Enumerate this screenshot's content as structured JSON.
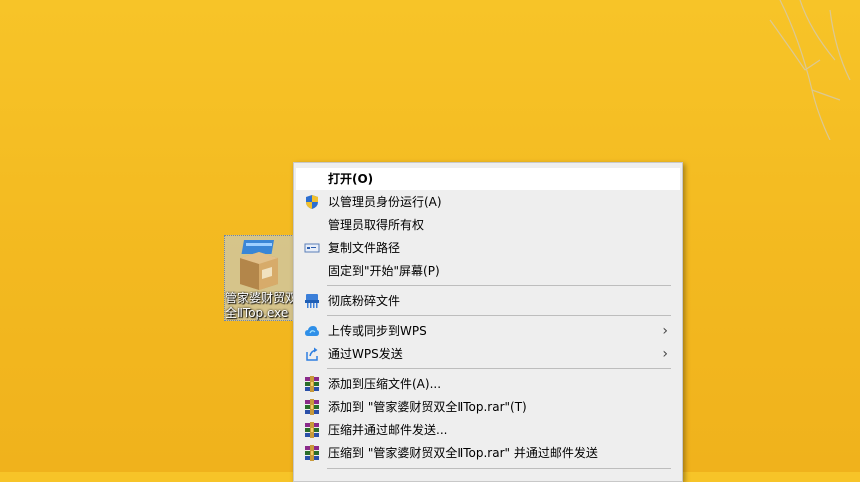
{
  "desktop": {
    "icon_label_line1": "管家婆财贸双",
    "icon_label_line2": "全ⅡTop.exe"
  },
  "context_menu": {
    "items": [
      {
        "label": "打开(O)",
        "icon": "none",
        "bold": true
      },
      {
        "label": "以管理员身份运行(A)",
        "icon": "uac-shield-icon"
      },
      {
        "label": "管理员取得所有权",
        "icon": "none"
      },
      {
        "label": "复制文件路径",
        "icon": "copy-path-icon"
      },
      {
        "label": "固定到\"开始\"屏幕(P)",
        "icon": "none"
      },
      {
        "label": "彻底粉碎文件",
        "icon": "shredder-icon"
      },
      {
        "label": "上传或同步到WPS",
        "icon": "wps-cloud-icon",
        "submenu": true
      },
      {
        "label": "通过WPS发送",
        "icon": "share-icon",
        "submenu": true
      },
      {
        "label": "添加到压缩文件(A)...",
        "icon": "winrar-icon"
      },
      {
        "label": "添加到 \"管家婆财贸双全ⅡTop.rar\"(T)",
        "icon": "winrar-icon"
      },
      {
        "label": "压缩并通过邮件发送...",
        "icon": "winrar-icon"
      },
      {
        "label": "压缩到 \"管家婆财贸双全ⅡTop.rar\" 并通过邮件发送",
        "icon": "winrar-icon"
      }
    ],
    "submenu_arrow": "›"
  },
  "colors": {
    "wallpaper": "#f3b920",
    "menu_bg": "#eeeeee",
    "menu_hover": "#ffffff"
  }
}
